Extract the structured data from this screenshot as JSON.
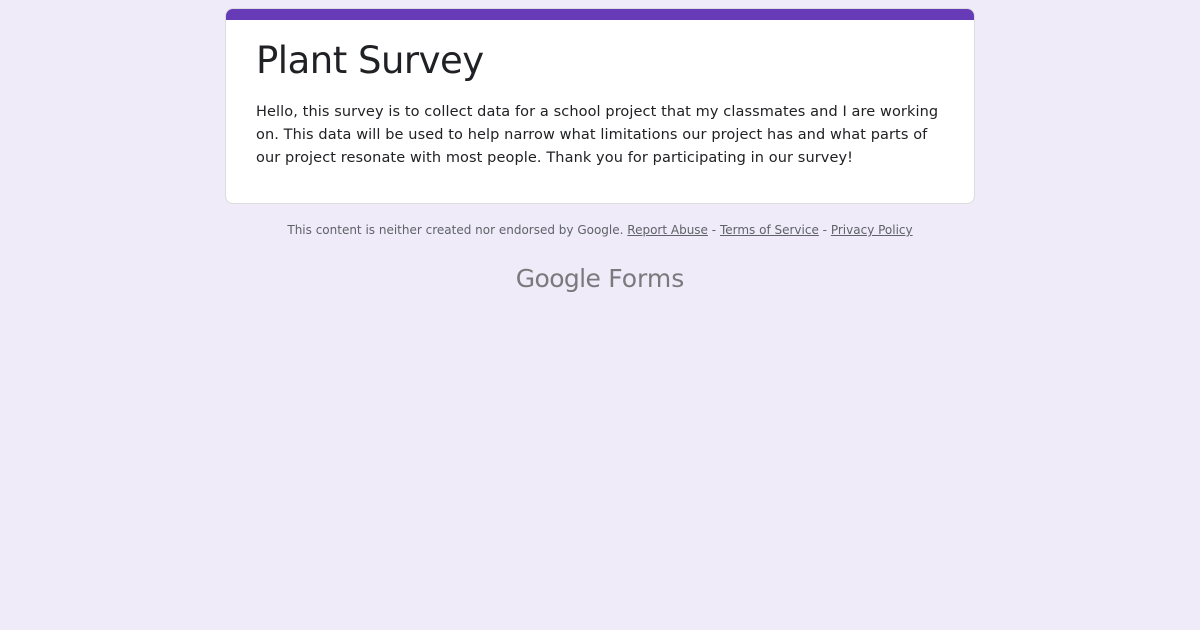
{
  "form": {
    "title": "Plant Survey",
    "description": "Hello, this survey is to collect data for a school project that my classmates and I are working on. This data will be used to help narrow what limitations our project has and what parts of our project resonate with most people. Thank you for participating in our survey!",
    "accent_color": "#673ab7"
  },
  "footer": {
    "disclaimer": "This content is neither created nor endorsed by Google.",
    "links": {
      "report_abuse": "Report Abuse",
      "terms": "Terms of Service",
      "privacy": "Privacy Policy"
    },
    "separator": "-"
  },
  "brand": {
    "logo_google": "Google",
    "logo_product": "Forms"
  },
  "colors": {
    "page_background": "#efebf8",
    "card_background": "#ffffff",
    "text": "#202124",
    "muted_text": "#5f6368"
  }
}
